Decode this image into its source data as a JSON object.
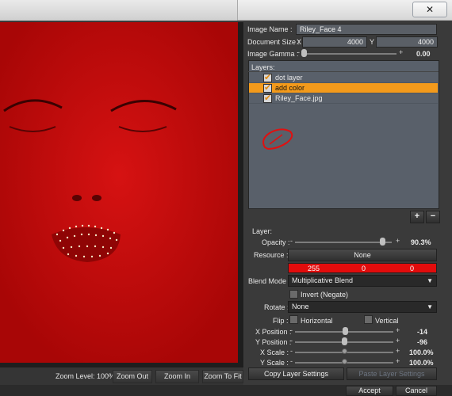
{
  "window": {
    "close_glyph": "✕"
  },
  "zoom": {
    "level_label": "Zoom Level: 100%",
    "zoom_out": "Zoom Out",
    "zoom_in": "Zoom In",
    "zoom_fit": "Zoom To Fit"
  },
  "image": {
    "name_label": "Image Name :",
    "name_value": "Riley_Face 4",
    "docsize_label": "Document Size :",
    "x_label": "X",
    "x_value": "4000",
    "y_label": "Y",
    "y_value": "4000",
    "gamma_label": "Image Gamma :",
    "gamma_minus": "-",
    "gamma_plus": "+",
    "gamma_value": "0.00",
    "gamma_fraction": 0.0
  },
  "layers": {
    "header": "Layers:",
    "items": [
      {
        "name": "dot layer",
        "checked": true,
        "selected": false
      },
      {
        "name": "add color",
        "checked": true,
        "selected": true
      },
      {
        "name": "Riley_Face.jpg",
        "checked": true,
        "selected": false
      }
    ],
    "add": "+",
    "remove": "−"
  },
  "layer": {
    "section_label": "Layer:",
    "opacity_label": "Opacity :",
    "opacity_value": "90.3%",
    "opacity_fraction": 0.903,
    "resource_label": "Resource :",
    "resource_value": "None",
    "color": {
      "r": "255",
      "g": "0",
      "b": "0",
      "hex": "#e20c0c"
    },
    "blend_label": "Blend Mode :",
    "blend_value": "Multiplicative Blend",
    "invert_label": "Invert (Negate)",
    "rotate_label": "Rotate :",
    "rotate_value": "None",
    "flip_label": "Flip :",
    "flip_h": "Horizontal",
    "flip_v": "Vertical",
    "xpos_label": "X Position :",
    "xpos_value": "-14",
    "ypos_label": "Y Position :",
    "ypos_value": "-96",
    "xscale_label": "X Scale :",
    "xscale_value": "100.0%",
    "yscale_label": "Y Scale :",
    "yscale_value": "100.0%",
    "minus": "-",
    "plus": "+",
    "copy_settings": "Copy Layer Settings",
    "paste_settings": "Paste Layer Settings"
  },
  "dialog": {
    "accept": "Accept",
    "cancel": "Cancel"
  },
  "colors": {
    "accent": "#f39a1b",
    "canvas_red": "#c40a0a",
    "panel": "#3a3a3a"
  }
}
